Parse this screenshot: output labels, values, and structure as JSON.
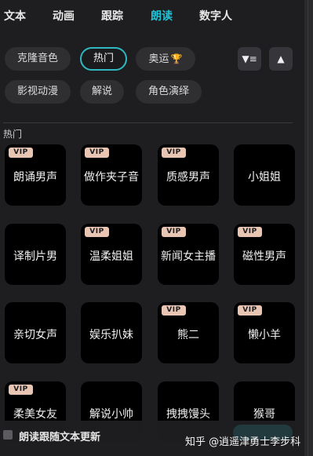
{
  "tabs": [
    {
      "label": "文本"
    },
    {
      "label": "动画"
    },
    {
      "label": "跟踪"
    },
    {
      "label": "朗读"
    },
    {
      "label": "数字人"
    }
  ],
  "active_tab": "朗读",
  "accent_color": "#20c2d7",
  "filters": {
    "row1": [
      "克隆音色",
      "热门",
      "奥运"
    ],
    "row2": [
      "影视动漫",
      "解说",
      "角色演绎"
    ],
    "active": "热门",
    "olympics_icon": "trophy-icon",
    "filter_icon": "filter-icon",
    "collapse_icon": "triangle-up-icon"
  },
  "section_title": "热门",
  "vip_badge": "VIP",
  "voices": [
    {
      "name": "朗诵男声",
      "vip": true
    },
    {
      "name": "做作夹子音",
      "vip": true
    },
    {
      "name": "质感男声",
      "vip": true
    },
    {
      "name": "小姐姐",
      "vip": false
    },
    {
      "name": "译制片男",
      "vip": false
    },
    {
      "name": "温柔姐姐",
      "vip": true
    },
    {
      "name": "新闻女主播",
      "vip": true
    },
    {
      "name": "磁性男声",
      "vip": true
    },
    {
      "name": "亲切女声",
      "vip": false
    },
    {
      "name": "娱乐扒妹",
      "vip": false
    },
    {
      "name": "熊二",
      "vip": true
    },
    {
      "name": "懒小羊",
      "vip": true
    },
    {
      "name": "柔美女友",
      "vip": true
    },
    {
      "name": "解说小帅",
      "vip": false
    },
    {
      "name": "拽拽馒头",
      "vip": false
    },
    {
      "name": "猴哥",
      "vip": false
    }
  ],
  "bottom": {
    "follow_text_label": "朗读跟随文本更新",
    "watermark": "知乎 @逍遥津勇士李步科"
  }
}
